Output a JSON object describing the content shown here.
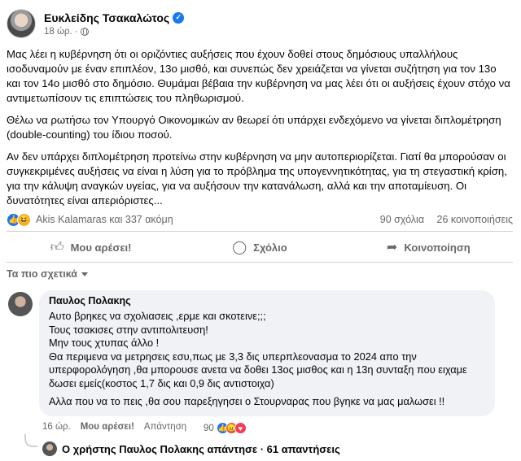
{
  "post": {
    "author": "Ευκλείδης Τσακαλώτος",
    "time": "18 ώρ.",
    "paragraphs": [
      "Μας λέει η κυβέρνηση ότι οι οριζόντιες αυξήσεις που έχουν δοθεί στους δημόσιους υπαλλήλους ισοδυναμούν με έναν επιπλέον, 13ο μισθό, και συνεπώς δεν χρειάζεται να γίνεται συζήτηση για τον 13ο και τον 14ο μισθό στο δημόσιο. Θυμάμαι βέβαια την κυβέρνηση να μας λέει ότι οι αυξήσεις έχουν στόχο να αντιμετωπίσουν τις επιπτώσεις του πληθωρισμού.",
      "Θέλω να ρωτήσω τον Υπουργό Οικονομικών αν θεωρεί ότι υπάρχει ενδεχόμενο να γίνεται διπλομέτρηση (double-counting) του ίδιου ποσού.",
      "Αν δεν υπάρχει διπλομέτρηση προτείνω στην κυβέρνηση να μην αυτοπεριορίζεται. Γιατί θα μπορούσαν οι συγκεκριμένες αυξήσεις να είναι η λύση για το πρόβλημα της υπογεννητικότητας, για τη στεγαστική κρίση, για την κάλυψη αναγκών υγείας, για να αυξήσουν την κατανάλωση, αλλά και την αποταμίευση. Οι δυνατότητες είναι απεριόριστες..."
    ],
    "reaction_names": "Akis Kalamaras και 337 ακόμη",
    "comments_count": "90 σχόλια",
    "shares_count": "26 κοινοποιήσεις"
  },
  "actions": {
    "like": "Μου αρέσει!",
    "comment": "Σχόλιο",
    "share": "Κοινοποίηση"
  },
  "filter": {
    "label": "Τα πιο σχετικά"
  },
  "comment": {
    "author": "Παυλος Πολακης",
    "lines": [
      "Αυτο βρηκες να σχολιασεις ,ερμε και σκοτεινε;;;",
      "Τους τσακισες στην αντιπολιτευση!",
      "Μην τους χτυπας άλλο !",
      "Θα περιμενα να μετρησεις εσυ,πως με 3,3 δις υπερπλεονασμα το 2024 απο την υπερφορολόγηση ,θα μπορουσε ανετα να δοθει 13ος μισθος και η 13η συνταξη που ειχαμε δωσει εμείς(κοστος 1,7 δις και 0,9 δις αντιστοιχα)",
      "Αλλα που να το πεις ,θα σου παρεξηγησει ο Στουρναρας που βγηκε να μας μαλωσει !!"
    ],
    "time": "16 ώρ.",
    "like": "Μου αρέσει!",
    "reply": "Απάντηση",
    "reactions_count": "90"
  },
  "reply_summary": {
    "text": "Ο χρήστης Παυλος Πολακης απάντησε · 61 απαντήσεις"
  }
}
